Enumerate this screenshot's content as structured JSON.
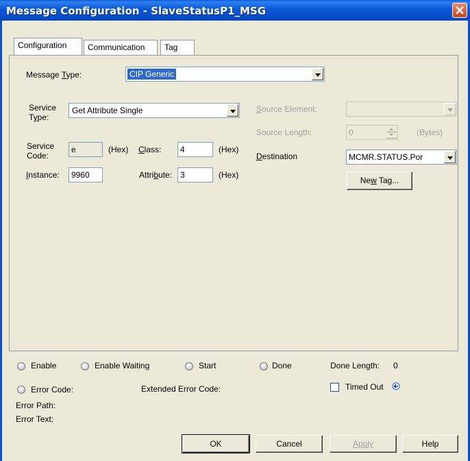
{
  "window": {
    "title": "Message Configuration - SlaveStatusP1_MSG"
  },
  "tabs": [
    {
      "label": "Configuration",
      "active": true
    },
    {
      "label": "Communication",
      "active": false
    },
    {
      "label": "Tag",
      "active": false
    }
  ],
  "config": {
    "message_type": {
      "label_pre": "Message ",
      "label_key": "T",
      "label_post": "ype:",
      "value": "CIP Generic"
    },
    "service_type": {
      "label_line1": "Service",
      "label_line2_key": "y",
      "label_line2_pre": "T",
      "label_line2_post": "pe:",
      "value": "Get Attribute Single"
    },
    "service_code": {
      "label_line1": "Service",
      "label_line2": "Code:",
      "value": "e",
      "unit": "(Hex)"
    },
    "class": {
      "label_key": "C",
      "label_post": "lass:",
      "value": "4",
      "unit": "(Hex)"
    },
    "instance": {
      "label_key": "I",
      "label_post": "nstance:",
      "value": "9960"
    },
    "attribute": {
      "label_pre": "Attri",
      "label_key": "b",
      "label_post": "ute:",
      "value": "3",
      "unit": "(Hex)"
    },
    "source_element": {
      "label_key": "S",
      "label_post": "ource Element:",
      "value": ""
    },
    "source_length": {
      "label": "Source Length:",
      "value": "0",
      "unit": "(Bytes)"
    },
    "destination": {
      "label_key": "D",
      "label_post": "estination",
      "value": "MCMR.STATUS.Por"
    },
    "new_tag_button": {
      "label_pre": "Ne",
      "label_key": "w",
      "label_post": " Tag..."
    }
  },
  "status": {
    "enable": "Enable",
    "enable_waiting": "Enable Waiting",
    "start": "Start",
    "done": "Done",
    "done_length_label": "Done Length:",
    "done_length_value": "0",
    "error_code": "Error Code:",
    "extended_error_code": "Extended Error Code:",
    "timed_out": "Timed Out",
    "error_path": "Error Path:",
    "error_text": "Error Text:"
  },
  "buttons": {
    "ok": "OK",
    "cancel": "Cancel",
    "apply": "Apply",
    "help": "Help"
  },
  "colors": {
    "title_bar": "#0a5fd8",
    "selection": "#316ac5",
    "dialog_bg": "#ece9d8"
  }
}
